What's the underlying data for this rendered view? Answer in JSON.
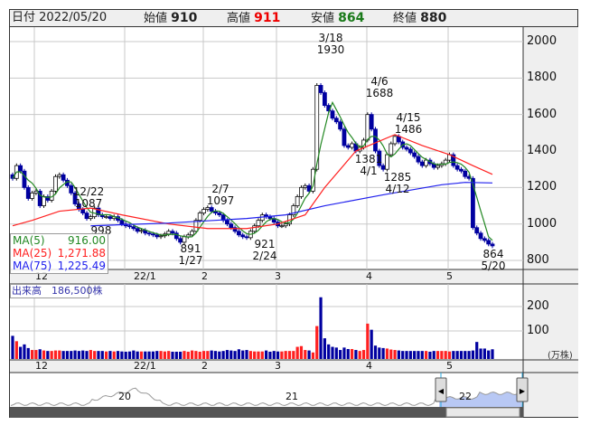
{
  "header": {
    "date_label": "日付",
    "date": "2022/05/20",
    "open_label": "始値",
    "open": "910",
    "high_label": "高値",
    "high": "911",
    "low_label": "安値",
    "low": "864",
    "close_label": "終値",
    "close": "880"
  },
  "legend": {
    "ma5_label": "MA(5)",
    "ma5": "916.00",
    "ma25_label": "MA(25)",
    "ma25": "1,271.88",
    "ma75_label": "MA(75)",
    "ma75": "1,225.49"
  },
  "volume_label": "出来高　186,500株",
  "volume_unit": "(万株)",
  "colors": {
    "up_volume": "#ff2020",
    "down": "#0000a0",
    "ma5": "#228822",
    "ma25": "#ff2020",
    "ma75": "#2020ee",
    "grid": "#c8c8c8",
    "panel": "#efefef",
    "nav_fill": "#b8c8f4"
  },
  "navigator": {
    "year_labels": [
      "20",
      "21",
      "22"
    ]
  },
  "chart_data": {
    "type": "candlestick",
    "title": "",
    "price_axis": {
      "ticks": [
        "2000",
        "1800",
        "1600",
        "1400",
        "1200",
        "1000",
        "800"
      ],
      "range": [
        800,
        2000
      ]
    },
    "volume_axis": {
      "ticks": [
        "200",
        "100"
      ],
      "unit": "万株",
      "range": [
        0,
        250
      ]
    },
    "month_labels": [
      "12",
      "22/1",
      "2",
      "3",
      "4",
      "5"
    ],
    "closes": [
      1250,
      1320,
      1290,
      1200,
      1140,
      1170,
      1180,
      1100,
      1150,
      1130,
      1180,
      1260,
      1270,
      1240,
      1210,
      1170,
      1110,
      1080,
      1060,
      1030,
      1040,
      1087,
      1050,
      1040,
      1040,
      1030,
      1040,
      1020,
      1000,
      990,
      985,
      975,
      960,
      965,
      950,
      945,
      940,
      930,
      935,
      945,
      960,
      950,
      920,
      900,
      930,
      940,
      960,
      1020,
      1060,
      1080,
      1090,
      1070,
      1060,
      1050,
      1020,
      1000,
      980,
      960,
      940,
      930,
      925,
      960,
      990,
      1020,
      1050,
      1040,
      1030,
      1010,
      990,
      990,
      1000,
      1050,
      1100,
      1150,
      1200,
      1210,
      1180,
      1300,
      1760,
      1720,
      1650,
      1620,
      1580,
      1560,
      1520,
      1430,
      1420,
      1440,
      1400,
      1420,
      1460,
      1600,
      1520,
      1400,
      1320,
      1300,
      1380,
      1440,
      1480,
      1450,
      1420,
      1410,
      1390,
      1370,
      1340,
      1320,
      1350,
      1330,
      1310,
      1320,
      1330,
      1350,
      1380,
      1320,
      1300,
      1290,
      1260,
      1250,
      980,
      950,
      920,
      910,
      890,
      880
    ],
    "volumes": [
      80,
      58,
      35,
      45,
      30,
      22,
      22,
      25,
      20,
      18,
      18,
      20,
      20,
      18,
      18,
      18,
      20,
      18,
      20,
      18,
      22,
      18,
      18,
      18,
      16,
      18,
      16,
      18,
      16,
      15,
      16,
      20,
      16,
      16,
      16,
      16,
      16,
      18,
      18,
      16,
      18,
      15,
      15,
      15,
      18,
      15,
      20,
      18,
      15,
      18,
      18,
      20,
      18,
      16,
      18,
      22,
      20,
      18,
      25,
      20,
      22,
      18,
      16,
      16,
      16,
      20,
      15,
      18,
      16,
      16,
      18,
      18,
      18,
      35,
      38,
      22,
      20,
      12,
      120,
      238,
      70,
      45,
      35,
      32,
      22,
      32,
      26,
      26,
      22,
      18,
      22,
      130,
      105,
      40,
      32,
      30,
      28,
      24,
      22,
      20,
      18,
      18,
      18,
      18,
      18,
      18,
      18,
      15,
      18,
      18,
      18,
      18,
      16,
      18,
      18,
      18,
      18,
      18,
      20,
      55,
      28,
      28,
      20,
      25
    ],
    "ma25_knots": [
      [
        0,
        990
      ],
      [
        5,
        1020
      ],
      [
        12,
        1070
      ],
      [
        20,
        1087
      ],
      [
        28,
        1050
      ],
      [
        40,
        1000
      ],
      [
        50,
        975
      ],
      [
        60,
        975
      ],
      [
        68,
        1000
      ],
      [
        75,
        1050
      ],
      [
        80,
        1200
      ],
      [
        88,
        1400
      ],
      [
        98,
        1490
      ],
      [
        105,
        1430
      ],
      [
        112,
        1380
      ],
      [
        118,
        1320
      ],
      [
        123,
        1272
      ]
    ],
    "ma75_knots": [
      [
        20,
        990
      ],
      [
        40,
        1005
      ],
      [
        60,
        1030
      ],
      [
        70,
        1050
      ],
      [
        80,
        1100
      ],
      [
        95,
        1160
      ],
      [
        110,
        1215
      ],
      [
        116,
        1228
      ],
      [
        123,
        1225
      ]
    ],
    "annotations": [
      {
        "date": "12/22",
        "value": "1087"
      },
      {
        "date": "",
        "value": "998"
      },
      {
        "date": "1/27",
        "value": "891"
      },
      {
        "date": "2/7",
        "value": "1097"
      },
      {
        "date": "2/24",
        "value": "921"
      },
      {
        "date": "3/18",
        "value": "1930"
      },
      {
        "date": "4/6",
        "value": "1688"
      },
      {
        "date": "4/1",
        "value": "1381"
      },
      {
        "date": "4/15",
        "value": "1486"
      },
      {
        "date": "4/12",
        "value": "1285"
      },
      {
        "date": "5/20",
        "value": "864"
      }
    ]
  }
}
